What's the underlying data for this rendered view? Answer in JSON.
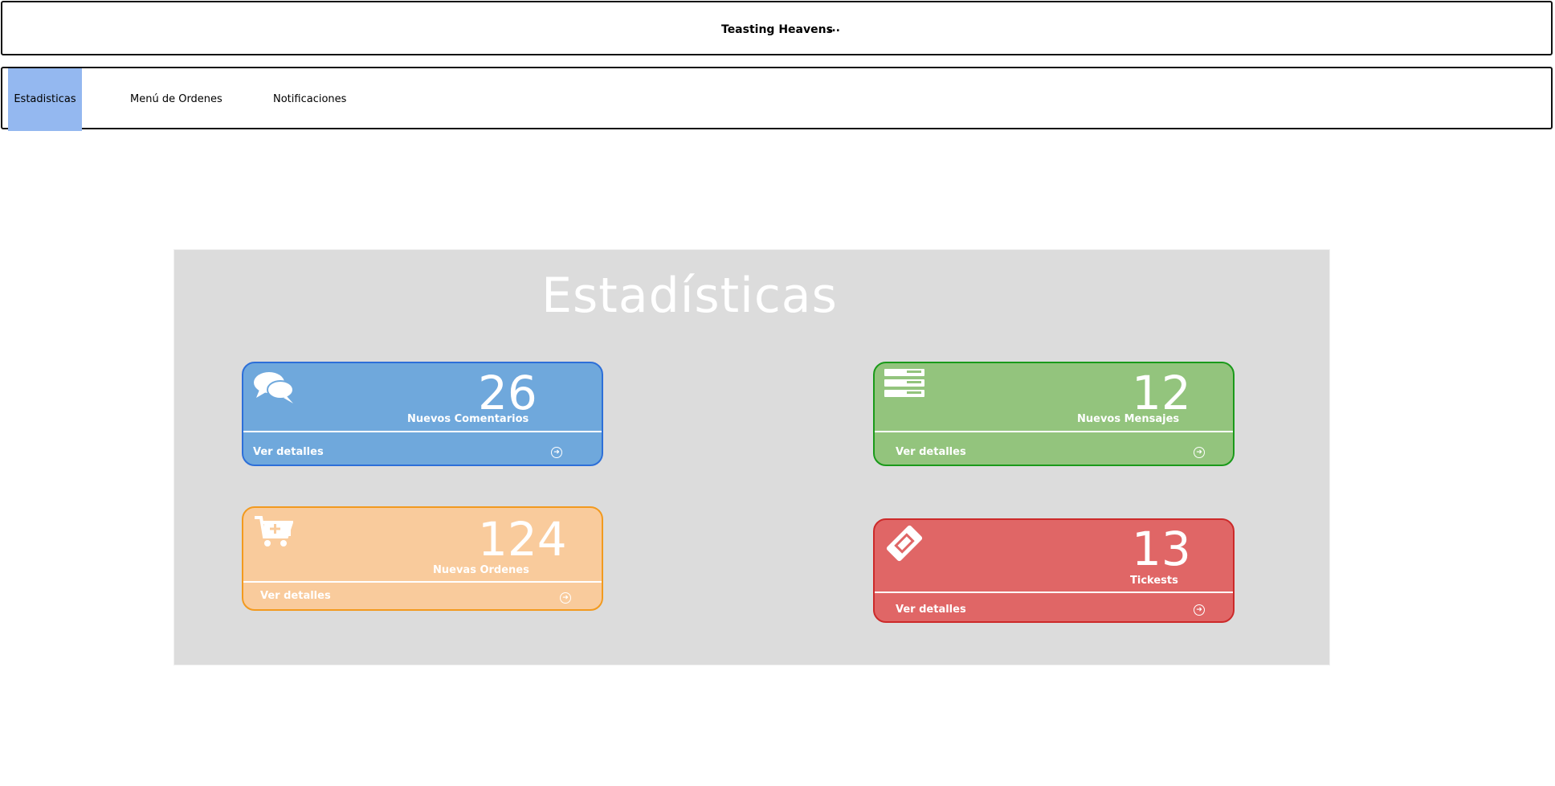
{
  "header": {
    "title": "Teasting Heavens",
    "more": "..."
  },
  "nav": {
    "items": [
      {
        "label": "Estadisticas",
        "active": true
      },
      {
        "label": "Menú de Ordenes",
        "active": false
      },
      {
        "label": "Notificaciones",
        "active": false
      }
    ]
  },
  "stats": {
    "title": "Estadísticas",
    "cards": [
      {
        "count": "26",
        "label": "Nuevos Comentarios",
        "details": "Ver detalles",
        "icon": "comments-icon",
        "color": "#6fa8dc"
      },
      {
        "count": "12",
        "label": "Nuevos Mensajes",
        "details": "Ver detalles",
        "icon": "list-icon",
        "color": "#93c47d"
      },
      {
        "count": "124",
        "label": "Nuevas Ordenes",
        "details": "Ver detalles",
        "icon": "cart-plus-icon",
        "color": "#f9cb9c"
      },
      {
        "count": "13",
        "label": "Tickests",
        "details": "Ver detalles",
        "icon": "ticket-icon",
        "color": "#e06666"
      }
    ]
  }
}
